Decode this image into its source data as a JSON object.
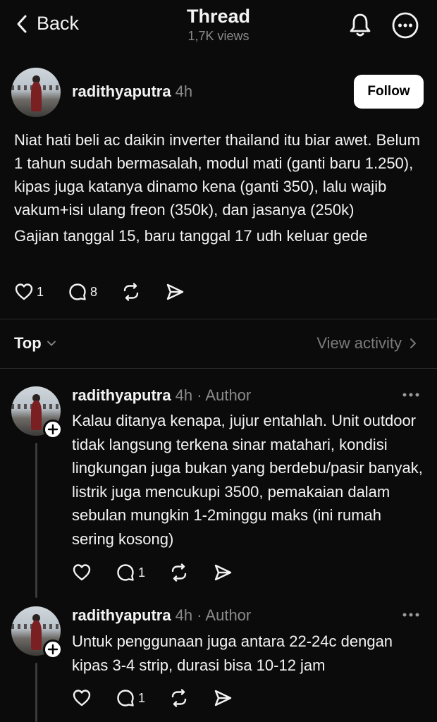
{
  "header": {
    "back_label": "Back",
    "title": "Thread",
    "subtitle": "1,7K views",
    "icons": [
      "chevron-left-icon",
      "bell-icon",
      "more-circle-icon"
    ]
  },
  "post": {
    "username": "radithyaputra",
    "time": "4h",
    "follow_label": "Follow",
    "paragraphs": [
      "Niat hati beli ac daikin inverter thailand itu biar awet. Belum 1 tahun sudah bermasalah, modul mati (ganti baru 1.250), kipas juga katanya dinamo kena (ganti 350), lalu wajib vakum+isi ulang freon (350k), dan jasanya (250k)",
      "Gajian tanggal 15, baru tanggal 17 udh keluar gede"
    ],
    "likes": "1",
    "comments": "8"
  },
  "sort": {
    "label": "Top",
    "view_activity": "View activity"
  },
  "replies": [
    {
      "username": "radithyaputra",
      "time": "4h",
      "tag": "· Author",
      "text": "Kalau ditanya kenapa, jujur entahlah. Unit outdoor tidak langsung terkena sinar matahari, kondisi lingkungan juga bukan yang berdebu/pasir banyak, listrik juga mencukupi 3500, pemakaian dalam sebulan mungkin 1-2minggu maks (ini rumah sering kosong)",
      "comments": "1"
    },
    {
      "username": "radithyaputra",
      "time": "4h",
      "tag": "· Author",
      "text": "Untuk penggunaan juga antara 22-24c dengan kipas 3-4 strip, durasi bisa 10-12 jam",
      "comments": "1"
    }
  ]
}
